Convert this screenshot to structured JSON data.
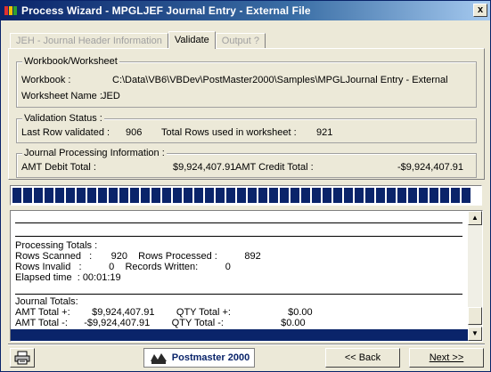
{
  "window": {
    "title": "Process Wizard - MPGLJEF Journal Entry - External File",
    "close_glyph": "x"
  },
  "tabs": [
    {
      "label": "JEH - Journal Header Information",
      "active": false
    },
    {
      "label": "Validate",
      "active": true
    },
    {
      "label": "Output ?",
      "active": false
    }
  ],
  "workbook": {
    "group_title": "Workbook/Worksheet",
    "workbook_label": "Workbook :",
    "workbook_value": "C:\\Data\\VB6\\VBDev\\PostMaster2000\\Samples\\MPGLJournal Entry - External",
    "worksheet_label": "Worksheet Name :",
    "worksheet_value": "JED"
  },
  "validation": {
    "group_title": "Validation Status :",
    "last_row_label": "Last Row validated :",
    "last_row_value": "906",
    "total_rows_label": "Total Rows used in worksheet :",
    "total_rows_value": "921"
  },
  "journal": {
    "group_title": "Journal Processing Information :",
    "debit_label": "AMT Debit Total :",
    "debit_value": "$9,924,407.91",
    "credit_label": "AMT Credit Total :",
    "credit_value": "-$9,924,407.91"
  },
  "progress": {
    "fraction": 1.0
  },
  "log": {
    "processing_totals": "Processing Totals :",
    "rows_scanned": "Rows Scanned   :       920    Rows Processed :          892",
    "rows_invalid": "Rows Invalid   :          0    Records Written:          0",
    "elapsed": "Elapsed time  : 00:01:19",
    "journal_totals": "Journal Totals:",
    "amt_plus": "AMT Total +:        $9,924,407.91        QTY Total +:                     $0.00",
    "amt_minus": "AMT Total -:      -$9,924,407.91        QTY Total -:                     $0.00"
  },
  "footer": {
    "print_icon": "printer-icon",
    "logo_text": "Postmaster 2000",
    "back_label": "<< Back",
    "next_label": "Next >>"
  }
}
